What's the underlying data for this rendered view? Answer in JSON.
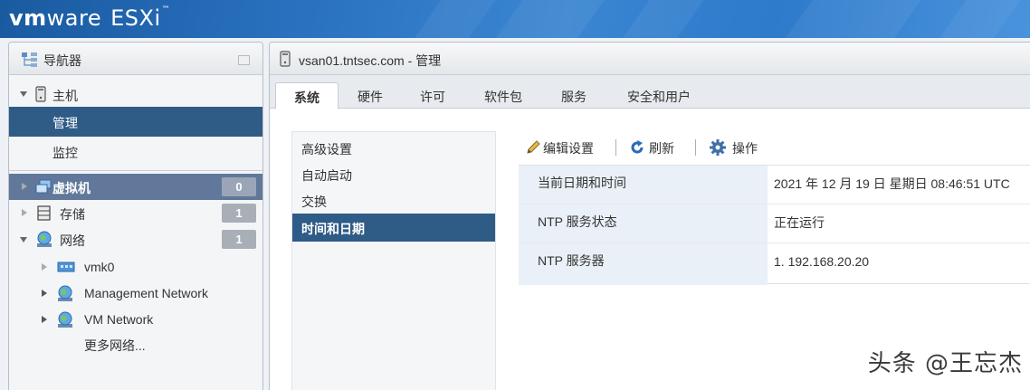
{
  "app": {
    "logo_vm": "vm",
    "logo_ware": "ware",
    "logo_product": "ESXi",
    "logo_tm": "™"
  },
  "navigator": {
    "title": "导航器",
    "host": {
      "label": "主机",
      "children": [
        {
          "label": "管理",
          "selected": true
        },
        {
          "label": "监控",
          "selected": false
        }
      ]
    },
    "sections": [
      {
        "label": "虚拟机",
        "count": "0"
      },
      {
        "label": "存储",
        "count": "1"
      },
      {
        "label": "网络",
        "count": "1"
      }
    ],
    "network_items": [
      {
        "label": "vmk0"
      },
      {
        "label": "Management Network"
      },
      {
        "label": "VM Network"
      }
    ],
    "more_networks": "更多网络..."
  },
  "main": {
    "title": "vsan01.tntsec.com - 管理",
    "tabs": [
      {
        "label": "系统",
        "active": true
      },
      {
        "label": "硬件",
        "active": false
      },
      {
        "label": "许可",
        "active": false
      },
      {
        "label": "软件包",
        "active": false
      },
      {
        "label": "服务",
        "active": false
      },
      {
        "label": "安全和用户",
        "active": false
      }
    ],
    "subnav": [
      {
        "label": "高级设置",
        "active": false
      },
      {
        "label": "自动启动",
        "active": false
      },
      {
        "label": "交换",
        "active": false
      },
      {
        "label": "时间和日期",
        "active": true
      }
    ],
    "toolbar": {
      "edit_label": "编辑设置",
      "refresh_label": "刷新",
      "actions_label": "操作"
    },
    "properties": [
      {
        "key": "当前日期和时间",
        "value": "2021 年 12 月 19 日 星期日 08:46:51 UTC"
      },
      {
        "key": "NTP 服务状态",
        "value": "正在运行"
      },
      {
        "key": "NTP 服务器",
        "value": "1. 192.168.20.20"
      }
    ]
  },
  "watermark": "头条 @王忘杰",
  "colors": {
    "banner": "#2a72c0",
    "selected": "#2f5b87",
    "vm_row": "#61789a",
    "badge": "#a8afb6",
    "key_cell": "#e9f0f7"
  }
}
